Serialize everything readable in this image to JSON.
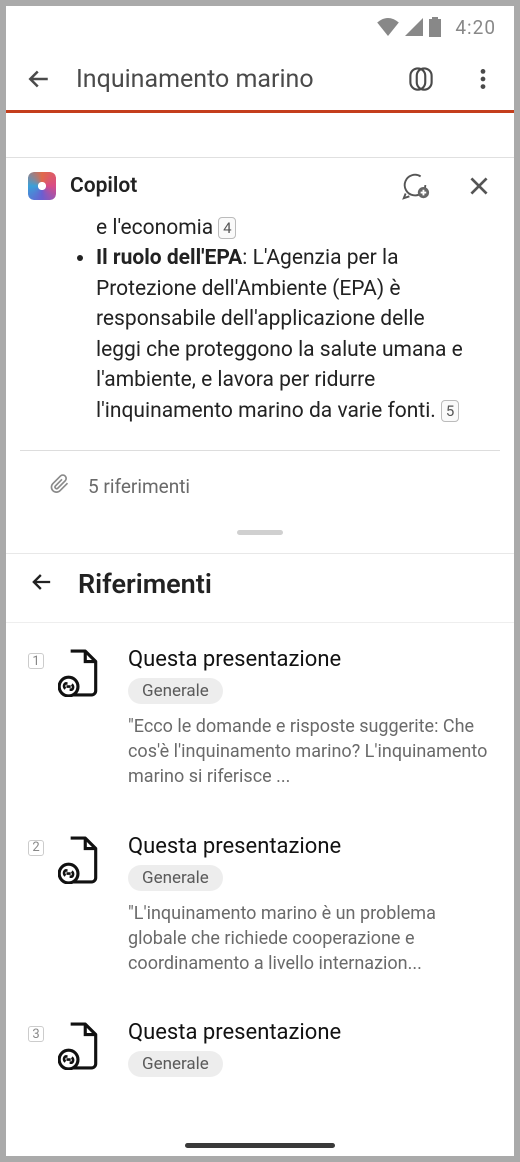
{
  "status": {
    "time": "4:20"
  },
  "header": {
    "title": "Inquinamento marino"
  },
  "copilot": {
    "title": "Copilot"
  },
  "message": {
    "partial_line_text": "e l'economia",
    "partial_line_citation": "4",
    "bullet_bold": "Il ruolo dell'EPA",
    "bullet_rest": ": L'Agenzia per la Protezione dell'Ambiente (EPA) è responsabile dell'applicazione delle leggi che proteggono la salute umana e l'ambiente, e lavora per ridurre l'inquinamento marino da varie fonti.",
    "bullet_citation": "5",
    "refs_count_label": "5 riferimenti"
  },
  "refs_panel": {
    "title": "Riferimenti"
  },
  "references": {
    "items": [
      {
        "num": "1",
        "title": "Questa presentazione",
        "tag": "Generale",
        "snippet": "\"Ecco le domande e risposte suggerite: Che cos'è l'inquinamento marino? L'inquinamento marino si riferisce ..."
      },
      {
        "num": "2",
        "title": "Questa presentazione",
        "tag": "Generale",
        "snippet": "\"L'inquinamento marino è un problema globale che richiede cooperazione e coordinamento a livello internazion..."
      },
      {
        "num": "3",
        "title": "Questa presentazione",
        "tag": "Generale",
        "snippet": ""
      }
    ]
  }
}
